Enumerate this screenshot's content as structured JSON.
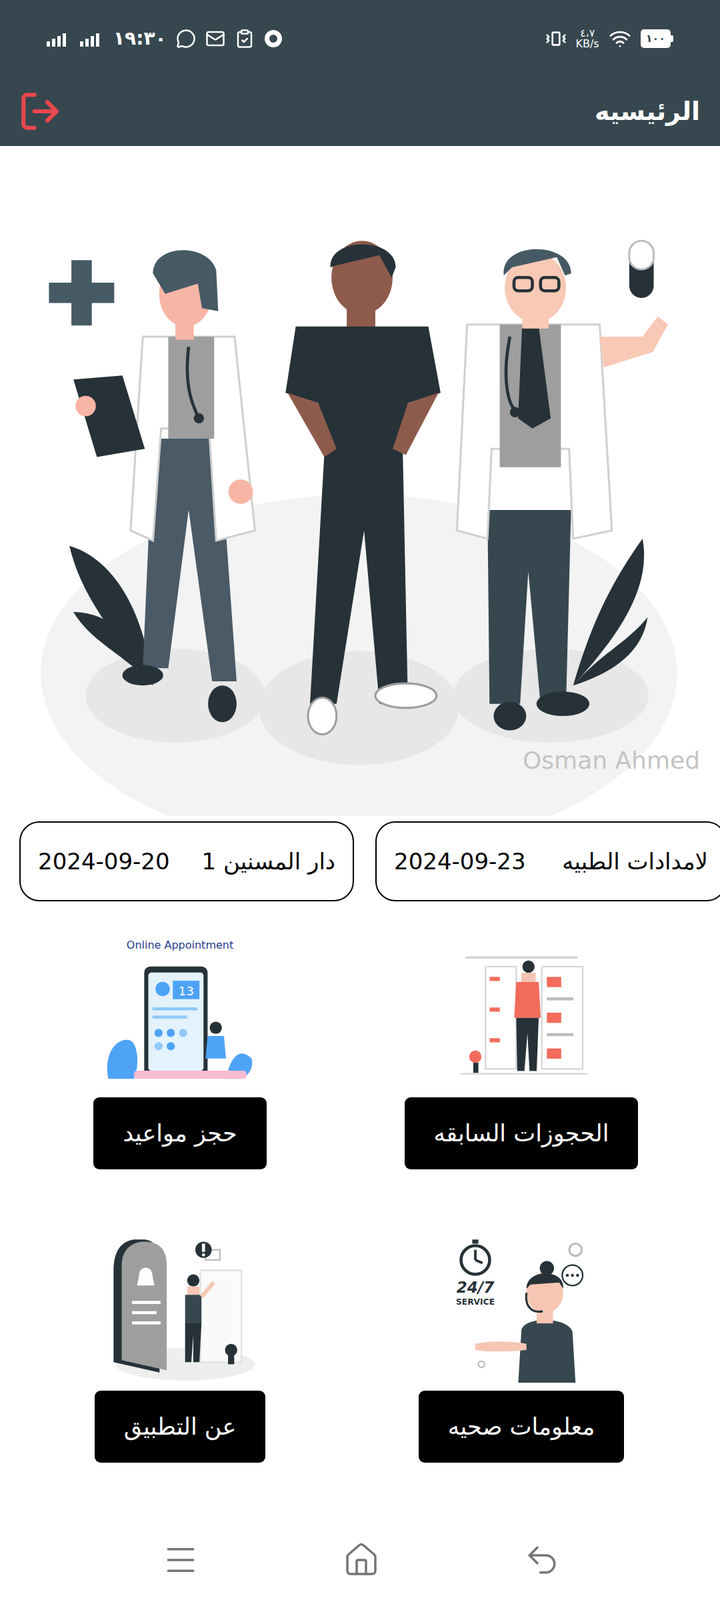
{
  "status_bar": {
    "time": "١٩:٣٠",
    "speed": "٤،٧",
    "speed_unit": "KB/s",
    "battery": "١٠٠"
  },
  "app_bar": {
    "title": "الرئيسيه"
  },
  "hero": {
    "watermark": "Osman Ahmed"
  },
  "events": [
    {
      "name": "لامدادات الطبيه",
      "date": "2024-09-23"
    },
    {
      "name": "دار المسنين 1",
      "date": "2024-09-20"
    }
  ],
  "menu": [
    {
      "label": "الحجوزات السابقه",
      "kind": "history",
      "art_text": []
    },
    {
      "label": "حجز مواعيد",
      "kind": "booking",
      "art_text": [
        "Online Appointment",
        "13"
      ]
    },
    {
      "label": "معلومات صحيه",
      "kind": "support",
      "art_text": [
        "24/7",
        "SERVICE"
      ]
    },
    {
      "label": "عن التطبيق",
      "kind": "about",
      "art_text": []
    }
  ]
}
